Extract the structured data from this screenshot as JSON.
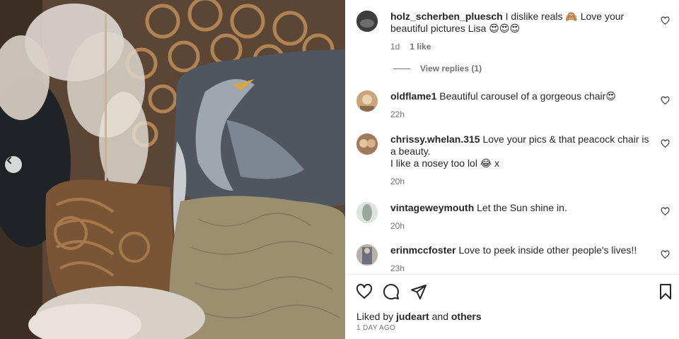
{
  "photo": {
    "alt_icon": "photo-of-peacock-chair-with-heron-cushion",
    "prev_icon": "chevron-left-icon"
  },
  "comments": [
    {
      "username": "holz_scherben_pluesch",
      "text": "I dislike reals 🙈 Love your beautiful pictures Lisa 😍😍😍",
      "time": "1d",
      "likes": "1 like",
      "avatar_color": "#3d3d3d"
    },
    {
      "username": "oldflame1",
      "text": "Beautiful carousel of a gorgeous chair😍",
      "time": "22h",
      "avatar_color": "#c9a57a"
    },
    {
      "username": "chrissy.whelan.315",
      "text": "Love your pics & that peacock chair is a beauty.",
      "text2": "I like a nosey too lol 😂 x",
      "time": "20h",
      "avatar_color": "#a07a5a"
    },
    {
      "username": "vintageweymouth",
      "text": "Let the Sun shine in.",
      "time": "20h",
      "avatar_color": "#9aa6a0"
    },
    {
      "username": "erinmccfoster",
      "text": "Love to peek inside other people's lives!!",
      "time": "23h",
      "avatar_color": "#6b6f80"
    }
  ],
  "view_replies": "View replies (1)",
  "actions": {
    "like_icon": "heart-icon",
    "comment_icon": "comment-icon",
    "share_icon": "share-icon",
    "save_icon": "bookmark-icon"
  },
  "liked_by": {
    "prefix": "Liked by",
    "user": "judeart",
    "connector": "and",
    "others": "others"
  },
  "post_date": "1 DAY AGO",
  "colors": {
    "text": "#262626",
    "secondary": "#737373",
    "divider": "#efefef"
  }
}
